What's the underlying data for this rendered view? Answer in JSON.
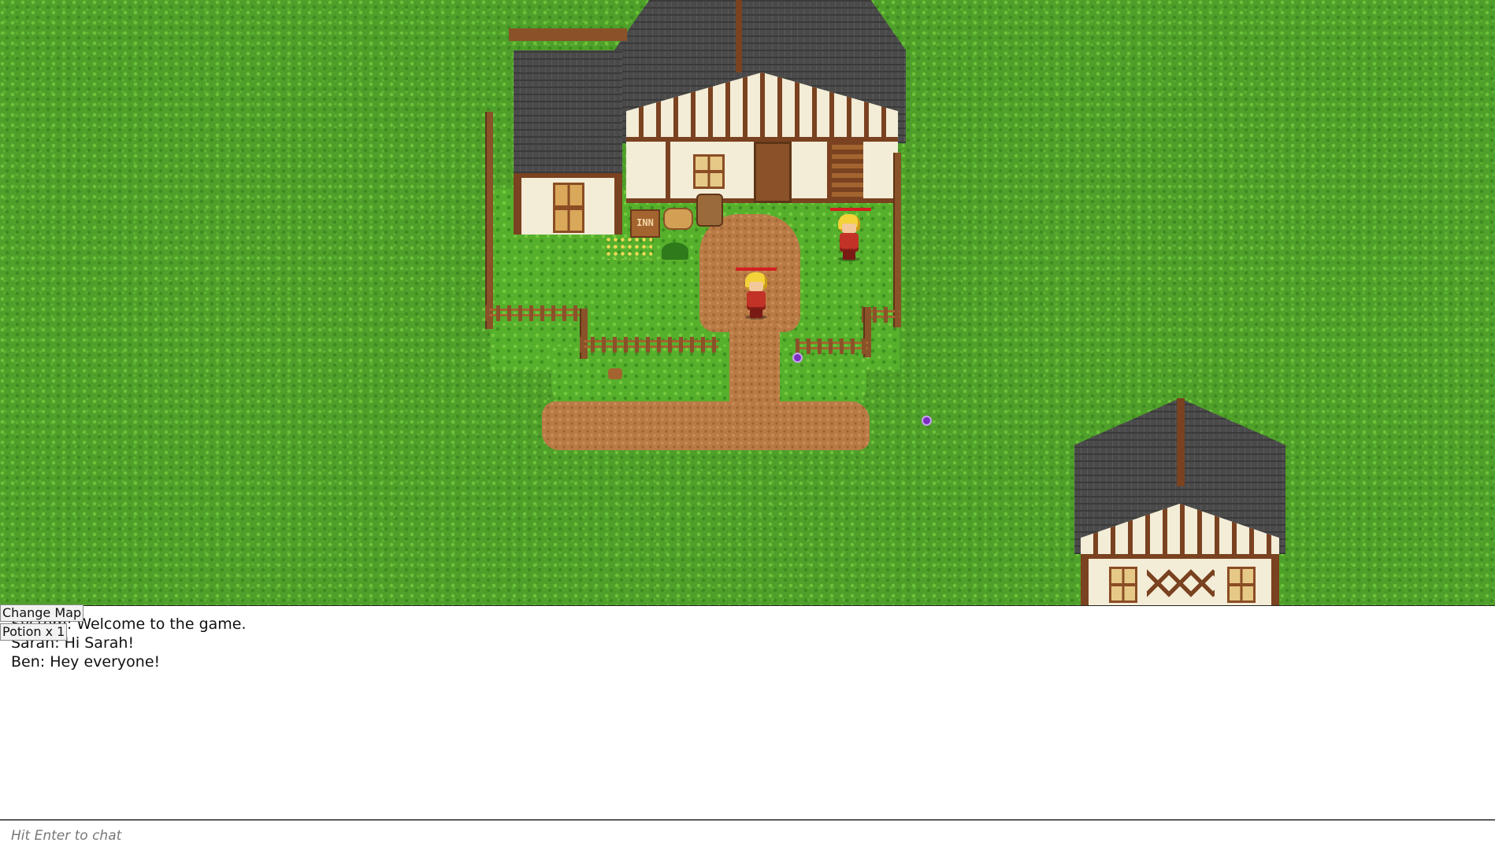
{
  "buttons": {
    "change_map": "Change Map",
    "potion": "Potion x 1"
  },
  "chat": {
    "messages": [
      "System: Welcome to the game.",
      "Sarah: Hi Sarah!",
      "Ben: Hey everyone!"
    ],
    "input_placeholder": "Hit Enter to chat"
  },
  "map": {
    "inn_sign": "INN"
  },
  "colors": {
    "grass": "#4fa02a",
    "path": "#b97a45",
    "hp_bar": "#d41f1f",
    "orb": "#7a2fc0"
  }
}
